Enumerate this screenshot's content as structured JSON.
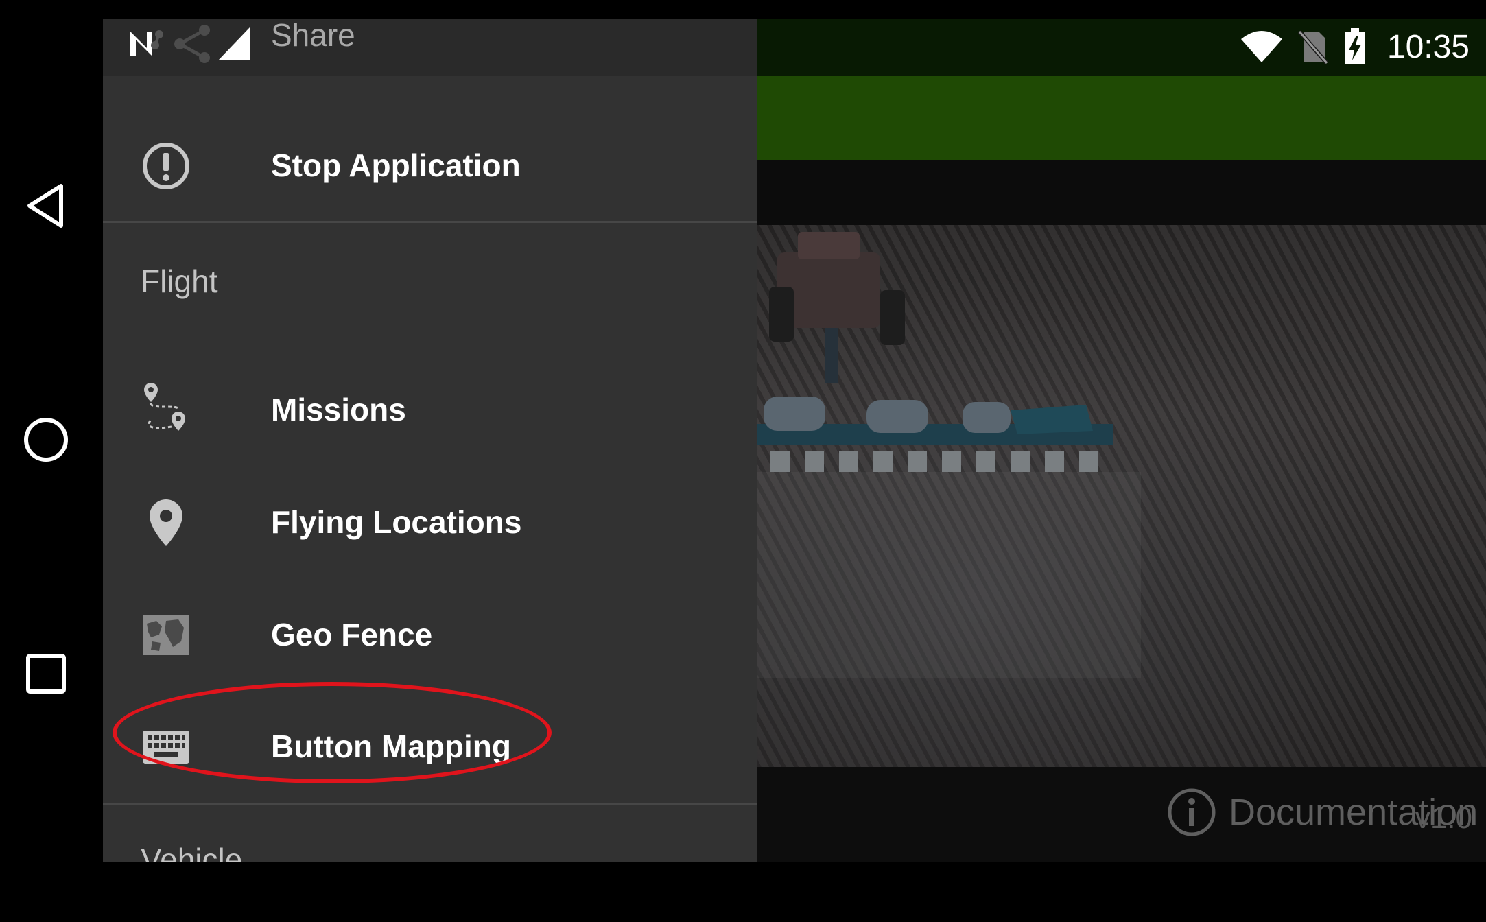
{
  "navbar": {
    "back_icon": "back-triangle-icon",
    "home_icon": "home-circle-icon",
    "recents_icon": "recents-square-icon"
  },
  "status_bar": {
    "time": "10:35",
    "icons": [
      "notification-n-icon",
      "share-icon",
      "signal-icon",
      "wifi-icon",
      "no-sim-icon",
      "battery-charging-icon"
    ]
  },
  "drawer": {
    "share_label": "Share",
    "items": [
      {
        "id": "stop",
        "label": "Stop Application",
        "icon": "alert-circle-icon"
      },
      {
        "id": "missions",
        "label": "Missions",
        "icon": "route-icon"
      },
      {
        "id": "locations",
        "label": "Flying Locations",
        "icon": "location-pin-icon"
      },
      {
        "id": "geofence",
        "label": "Geo Fence",
        "icon": "map-icon"
      },
      {
        "id": "buttonmap",
        "label": "Button Mapping",
        "icon": "keyboard-icon"
      }
    ],
    "sections": {
      "flight": "Flight",
      "vehicle": "Vehicle"
    }
  },
  "main": {
    "documentation_label": "Documentation",
    "version": "v1.0"
  },
  "colors": {
    "drawer_bg": "#323232",
    "toolbar_green": "#1f4a04",
    "highlight_red": "#e0141c"
  }
}
